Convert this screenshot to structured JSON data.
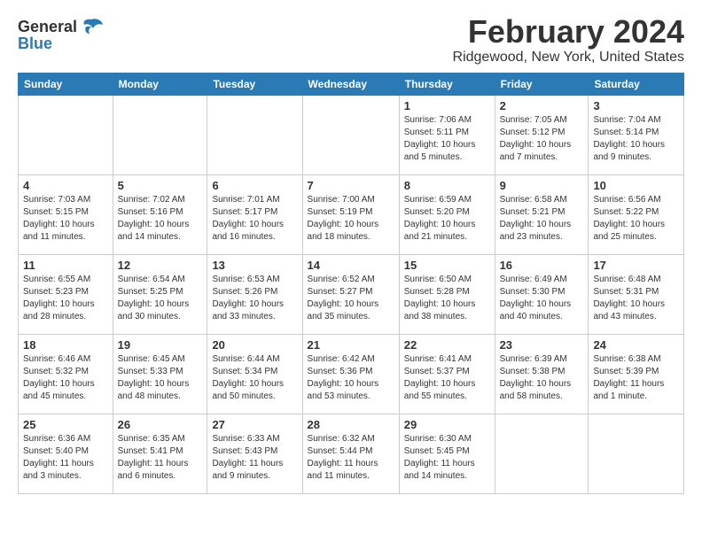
{
  "logo": {
    "general": "General",
    "blue": "Blue"
  },
  "header": {
    "title": "February 2024",
    "subtitle": "Ridgewood, New York, United States"
  },
  "days_of_week": [
    "Sunday",
    "Monday",
    "Tuesday",
    "Wednesday",
    "Thursday",
    "Friday",
    "Saturday"
  ],
  "weeks": [
    [
      {
        "day": "",
        "info": ""
      },
      {
        "day": "",
        "info": ""
      },
      {
        "day": "",
        "info": ""
      },
      {
        "day": "",
        "info": ""
      },
      {
        "day": "1",
        "info": "Sunrise: 7:06 AM\nSunset: 5:11 PM\nDaylight: 10 hours\nand 5 minutes."
      },
      {
        "day": "2",
        "info": "Sunrise: 7:05 AM\nSunset: 5:12 PM\nDaylight: 10 hours\nand 7 minutes."
      },
      {
        "day": "3",
        "info": "Sunrise: 7:04 AM\nSunset: 5:14 PM\nDaylight: 10 hours\nand 9 minutes."
      }
    ],
    [
      {
        "day": "4",
        "info": "Sunrise: 7:03 AM\nSunset: 5:15 PM\nDaylight: 10 hours\nand 11 minutes."
      },
      {
        "day": "5",
        "info": "Sunrise: 7:02 AM\nSunset: 5:16 PM\nDaylight: 10 hours\nand 14 minutes."
      },
      {
        "day": "6",
        "info": "Sunrise: 7:01 AM\nSunset: 5:17 PM\nDaylight: 10 hours\nand 16 minutes."
      },
      {
        "day": "7",
        "info": "Sunrise: 7:00 AM\nSunset: 5:19 PM\nDaylight: 10 hours\nand 18 minutes."
      },
      {
        "day": "8",
        "info": "Sunrise: 6:59 AM\nSunset: 5:20 PM\nDaylight: 10 hours\nand 21 minutes."
      },
      {
        "day": "9",
        "info": "Sunrise: 6:58 AM\nSunset: 5:21 PM\nDaylight: 10 hours\nand 23 minutes."
      },
      {
        "day": "10",
        "info": "Sunrise: 6:56 AM\nSunset: 5:22 PM\nDaylight: 10 hours\nand 25 minutes."
      }
    ],
    [
      {
        "day": "11",
        "info": "Sunrise: 6:55 AM\nSunset: 5:23 PM\nDaylight: 10 hours\nand 28 minutes."
      },
      {
        "day": "12",
        "info": "Sunrise: 6:54 AM\nSunset: 5:25 PM\nDaylight: 10 hours\nand 30 minutes."
      },
      {
        "day": "13",
        "info": "Sunrise: 6:53 AM\nSunset: 5:26 PM\nDaylight: 10 hours\nand 33 minutes."
      },
      {
        "day": "14",
        "info": "Sunrise: 6:52 AM\nSunset: 5:27 PM\nDaylight: 10 hours\nand 35 minutes."
      },
      {
        "day": "15",
        "info": "Sunrise: 6:50 AM\nSunset: 5:28 PM\nDaylight: 10 hours\nand 38 minutes."
      },
      {
        "day": "16",
        "info": "Sunrise: 6:49 AM\nSunset: 5:30 PM\nDaylight: 10 hours\nand 40 minutes."
      },
      {
        "day": "17",
        "info": "Sunrise: 6:48 AM\nSunset: 5:31 PM\nDaylight: 10 hours\nand 43 minutes."
      }
    ],
    [
      {
        "day": "18",
        "info": "Sunrise: 6:46 AM\nSunset: 5:32 PM\nDaylight: 10 hours\nand 45 minutes."
      },
      {
        "day": "19",
        "info": "Sunrise: 6:45 AM\nSunset: 5:33 PM\nDaylight: 10 hours\nand 48 minutes."
      },
      {
        "day": "20",
        "info": "Sunrise: 6:44 AM\nSunset: 5:34 PM\nDaylight: 10 hours\nand 50 minutes."
      },
      {
        "day": "21",
        "info": "Sunrise: 6:42 AM\nSunset: 5:36 PM\nDaylight: 10 hours\nand 53 minutes."
      },
      {
        "day": "22",
        "info": "Sunrise: 6:41 AM\nSunset: 5:37 PM\nDaylight: 10 hours\nand 55 minutes."
      },
      {
        "day": "23",
        "info": "Sunrise: 6:39 AM\nSunset: 5:38 PM\nDaylight: 10 hours\nand 58 minutes."
      },
      {
        "day": "24",
        "info": "Sunrise: 6:38 AM\nSunset: 5:39 PM\nDaylight: 11 hours\nand 1 minute."
      }
    ],
    [
      {
        "day": "25",
        "info": "Sunrise: 6:36 AM\nSunset: 5:40 PM\nDaylight: 11 hours\nand 3 minutes."
      },
      {
        "day": "26",
        "info": "Sunrise: 6:35 AM\nSunset: 5:41 PM\nDaylight: 11 hours\nand 6 minutes."
      },
      {
        "day": "27",
        "info": "Sunrise: 6:33 AM\nSunset: 5:43 PM\nDaylight: 11 hours\nand 9 minutes."
      },
      {
        "day": "28",
        "info": "Sunrise: 6:32 AM\nSunset: 5:44 PM\nDaylight: 11 hours\nand 11 minutes."
      },
      {
        "day": "29",
        "info": "Sunrise: 6:30 AM\nSunset: 5:45 PM\nDaylight: 11 hours\nand 14 minutes."
      },
      {
        "day": "",
        "info": ""
      },
      {
        "day": "",
        "info": ""
      }
    ]
  ]
}
